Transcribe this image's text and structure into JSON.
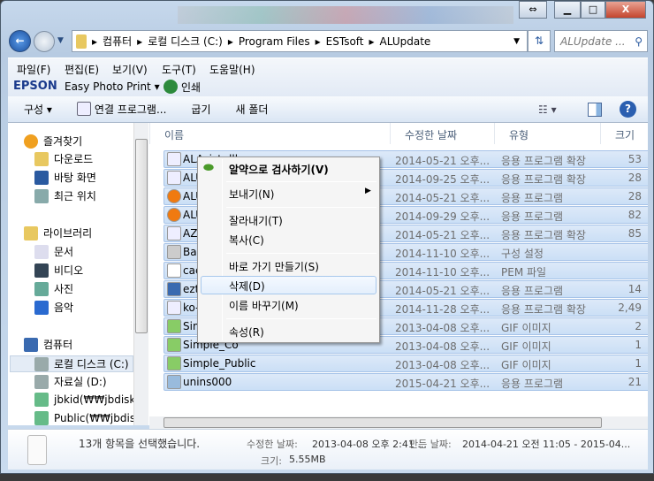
{
  "window": {
    "restore_label": "⇔",
    "minimize_label": "▁",
    "maximize_label": "□",
    "close_label": "X"
  },
  "address": {
    "crumbs": [
      "컴퓨터",
      "로컬 디스크 (C:)",
      "Program Files",
      "ESTsoft",
      "ALUpdate"
    ],
    "search_placeholder": "ALUpdate ..."
  },
  "menu": [
    "파일(F)",
    "편집(E)",
    "보기(V)",
    "도구(T)",
    "도움말(H)"
  ],
  "epson": {
    "brand": "EPSON",
    "app": "Easy Photo Print",
    "print": "인쇄"
  },
  "toolbar": {
    "organize": "구성 ▾",
    "open_with": "연결 프로그램...",
    "burn": "굽기",
    "new_folder": "새 폴더"
  },
  "nav": [
    {
      "label": "즐겨찾기",
      "icon": "star-icon",
      "indent": 0
    },
    {
      "label": "다운로드",
      "icon": "downloads-icon",
      "indent": 1
    },
    {
      "label": "바탕 화면",
      "icon": "desktop-icon",
      "indent": 1
    },
    {
      "label": "최근 위치",
      "icon": "recent-icon",
      "indent": 1
    },
    {
      "label": "라이브러리",
      "icon": "library-icon",
      "indent": 0
    },
    {
      "label": "문서",
      "icon": "document-icon",
      "indent": 1
    },
    {
      "label": "비디오",
      "icon": "video-icon",
      "indent": 1
    },
    {
      "label": "사진",
      "icon": "picture-icon",
      "indent": 1
    },
    {
      "label": "음악",
      "icon": "music-icon",
      "indent": 1
    },
    {
      "label": "컴퓨터",
      "icon": "computer-icon",
      "indent": 0
    },
    {
      "label": "로컬 디스크 (C:)",
      "icon": "drive-icon",
      "indent": 1,
      "selected": true
    },
    {
      "label": "자료실 (D:)",
      "icon": "drive-icon",
      "indent": 1
    },
    {
      "label": "jbkid(₩₩jbdisk)",
      "icon": "network-drive-icon",
      "indent": 1
    },
    {
      "label": "Public(₩₩jbdisk)",
      "icon": "network-drive-icon",
      "indent": 1
    }
  ],
  "columns": {
    "name": "이름",
    "date": "수정한 날짜",
    "type": "유형",
    "size": "크기"
  },
  "files": [
    {
      "name": "ALAsist.dll",
      "date": "2014-05-21 오후...",
      "type": "응용 프로그램 확장",
      "size": "53",
      "icon": "dll-icon"
    },
    {
      "name": "ALU",
      "date": "2014-09-25 오후...",
      "type": "응용 프로그램 확장",
      "size": "28",
      "icon": "dll-icon"
    },
    {
      "name": "ALU",
      "date": "2014-05-21 오후...",
      "type": "응용 프로그램",
      "size": "28",
      "icon": "alupdate-icon"
    },
    {
      "name": "ALU",
      "date": "2014-09-29 오후...",
      "type": "응용 프로그램",
      "size": "82",
      "icon": "alupdate-icon"
    },
    {
      "name": "AZ",
      "date": "2014-05-21 오후...",
      "type": "응용 프로그램 확장",
      "size": "85",
      "icon": "dll-icon"
    },
    {
      "name": "Bar",
      "date": "2014-11-10 오후...",
      "type": "구성 설정",
      "size": "",
      "icon": "config-icon"
    },
    {
      "name": "cac",
      "date": "2014-11-10 오후...",
      "type": "PEM 파일",
      "size": "",
      "icon": "file-icon"
    },
    {
      "name": "ezt",
      "date": "2014-05-21 오후...",
      "type": "응용 프로그램",
      "size": "14",
      "icon": "window-icon"
    },
    {
      "name": "ko-",
      "date": "2014-11-28 오후...",
      "type": "응용 프로그램 확장",
      "size": "2,49",
      "icon": "dll-icon"
    },
    {
      "name": "Sim",
      "date": "2013-04-08 오후...",
      "type": "GIF 이미지",
      "size": "2",
      "icon": "image-icon"
    },
    {
      "name": "Simple_Co",
      "date": "2013-04-08 오후...",
      "type": "GIF 이미지",
      "size": "1",
      "icon": "image-icon"
    },
    {
      "name": "Simple_Public",
      "date": "2013-04-08 오후...",
      "type": "GIF 이미지",
      "size": "1",
      "icon": "image-icon"
    },
    {
      "name": "unins000",
      "date": "2015-04-21 오후...",
      "type": "응용 프로그램",
      "size": "21",
      "icon": "uninstall-icon"
    }
  ],
  "context_menu": {
    "scan": "알약으로 검사하기(V)",
    "send_to": "보내기(N)",
    "cut": "잘라내기(T)",
    "copy": "복사(C)",
    "shortcut": "바로 가기 만들기(S)",
    "delete": "삭제(D)",
    "rename": "이름 바꾸기(M)",
    "properties": "속성(R)"
  },
  "status": {
    "selected": "13개 항목을 선택했습니다.",
    "modified_label": "수정한 날짜:",
    "modified": "2013-04-08 오후 2:41 ...",
    "created_label": "만든 날짜:",
    "created": "2014-04-21 오전 11:05 - 2015-04...",
    "size_label": "크기:",
    "size": "5.55MB"
  }
}
